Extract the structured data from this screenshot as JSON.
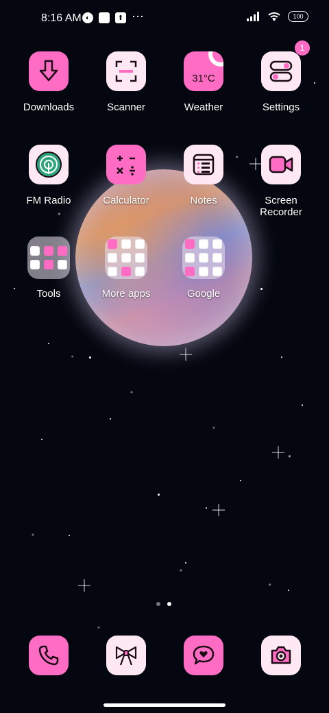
{
  "status_bar": {
    "time": "8:16 AM",
    "more": "⋯",
    "battery": "100"
  },
  "apps": {
    "downloads": "Downloads",
    "scanner": "Scanner",
    "weather": "Weather",
    "weather_temp": "31°C",
    "settings": "Settings",
    "settings_badge": "1",
    "fm_radio": "FM Radio",
    "calculator": "Calculator",
    "notes": "Notes",
    "screen_recorder": "Screen\nRecorder"
  },
  "folders": {
    "tools": "Tools",
    "more_apps": "More apps",
    "google": "Google"
  },
  "dock": [
    "phone-icon",
    "bow-icon",
    "messages-icon",
    "camera-icon"
  ],
  "colors": {
    "accent": "#ff6cc3",
    "tile_light": "#fde8f3",
    "background": "#04070f"
  }
}
